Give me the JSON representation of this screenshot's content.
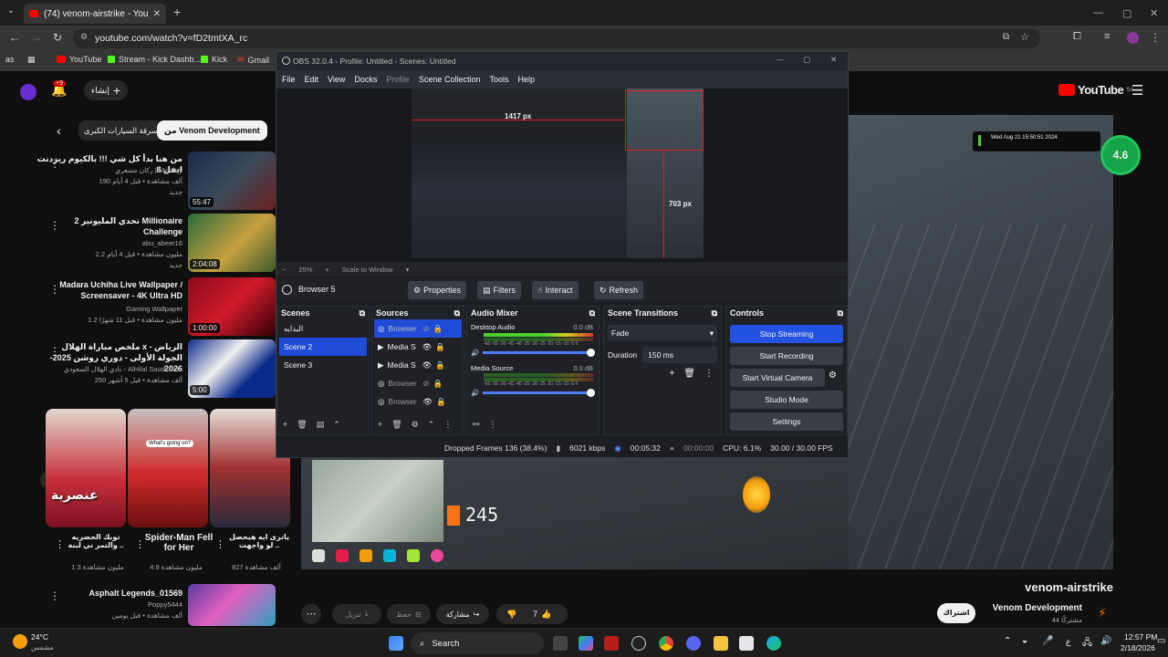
{
  "browser": {
    "tab_title": "(74) venom-airstrike - YouTube",
    "url": "youtube.com/watch?v=fD2tmtXA_rc",
    "bookmarks": [
      "YouTube",
      "Stream - Kick Dashb...",
      "Kick",
      "Gmail"
    ],
    "profile_badge": "as"
  },
  "youtube": {
    "logo_text": "YouTube",
    "region": "SA",
    "create_label": "إنشاء",
    "notif_count": "+9",
    "chips": [
      "من Venom Development",
      "سرقة السيارات الكبرى"
    ],
    "rating_badge": "4.6",
    "videos": [
      {
        "title": "من هنا بدأ كل شي !!! بالكيوم ريزدنت ايفل 8",
        "channel": "ركان مسعري | Mystery",
        "meta": "190 ألف مشاهدة • قبل 4 أيام",
        "badge": "جديد",
        "duration": "55:47"
      },
      {
        "title": "تحدي المليونير 2 Millionaire Challenge",
        "channel": "abu_abeer16",
        "meta": "2.2 مليون مشاهدة • قبل 4 أيام",
        "badge": "جديد",
        "duration": "2:04:08"
      },
      {
        "title": "Madara Uchiha Live Wallpaper / Screensaver - 4K Ultra HD",
        "channel": "Gaming Wallpaper",
        "meta": "1.2 مليون مشاهدة • قبل 11 شهرًا",
        "badge": "",
        "duration": "1:00:00"
      },
      {
        "title": "ملخص مباراة الهلال x الرياض - الجولة الأولى - دوري روشن 2025-2026",
        "channel": "نادي الهلال السعودي - AlHilal Saudi Club",
        "meta": "250 ألف مشاهدة • قبل 5 أشهر",
        "badge": "",
        "duration": "5:00"
      }
    ],
    "shorts": [
      {
        "title": "توبك الحضريه والتمر ني لبنة ..",
        "views": "1.3 مليون مشاهدة",
        "overlay": "عنصرية"
      },
      {
        "title": "Spider-Man Fell for Her",
        "views": "4.9 مليون مشاهدة",
        "overlay": "What's going on?"
      },
      {
        "title": "ياترى ايه هيحصل لو واجهت ..",
        "views": "827 ألف مشاهدة",
        "overlay": ""
      }
    ],
    "last_video": {
      "title": "Asphalt Legends_01569",
      "channel": "Poppy5444",
      "meta": "ألف مشاهدة • قبل يومين"
    },
    "video_title": "venom-airstrike",
    "channel_name": "Venom Development",
    "subscribers": "44 مشتركًا",
    "subscribe_label": "اشتراك",
    "like_count": "7",
    "share_label": "مشاركة",
    "download_label": "تنزيل",
    "save_label": "حفظ",
    "overlay_timestamp": "Wed Aug 21 15:50:51 2024",
    "hud_speed": "245"
  },
  "obs": {
    "title": "OBS 32.0.4 - Profile: Untitled - Scenes: Untitled",
    "menu": [
      "File",
      "Edit",
      "View",
      "Docks",
      "Profile",
      "Scene Collection",
      "Tools",
      "Help"
    ],
    "preview_labels": {
      "width": "1417 px",
      "height": "703 px"
    },
    "zoom": "25%",
    "scale_mode": "Scale to Window",
    "selected_source": "Browser 5",
    "source_buttons": {
      "properties": "Properties",
      "filters": "Filters",
      "interact": "Interact",
      "refresh": "Refresh"
    },
    "docks": {
      "scenes": "Scenes",
      "sources": "Sources",
      "mixer": "Audio Mixer",
      "transitions": "Scene Transitions",
      "controls": "Controls"
    },
    "scenes": [
      "البدايه",
      "Scene 2",
      "Scene 3"
    ],
    "sources": [
      "Browser",
      "Media S",
      "Media S",
      "Browser",
      "Browser"
    ],
    "mixer": [
      {
        "name": "Desktop Audio",
        "db": "0.0 dB"
      },
      {
        "name": "Media Source",
        "db": "0.0 dB"
      }
    ],
    "meter_ticks": "-60 -55 -50 -45 -40 -35 -30 -25 -20 -15 -10 -5 0",
    "transition": {
      "type": "Fade",
      "duration_label": "Duration",
      "duration": "150 ms"
    },
    "controls": [
      "Stop Streaming",
      "Start Recording",
      "Start Virtual Camera",
      "Studio Mode",
      "Settings"
    ],
    "status": {
      "dropped": "Dropped Frames 136 (38.4%)",
      "bitrate": "6021 kbps",
      "stream_time": "00:05:32",
      "rec_time": "00:00:00",
      "cpu": "CPU: 6.1%",
      "fps": "30.00 / 30.00 FPS"
    }
  },
  "taskbar": {
    "weather_temp": "24°C",
    "weather_desc": "مشمس",
    "search_label": "Search",
    "time": "12:57 PM",
    "date": "2/18/2026",
    "lang": "ع"
  },
  "colors": {
    "yt_red": "#ff0000",
    "obs_blue": "#2452e0",
    "kick_green": "#53fc18"
  }
}
